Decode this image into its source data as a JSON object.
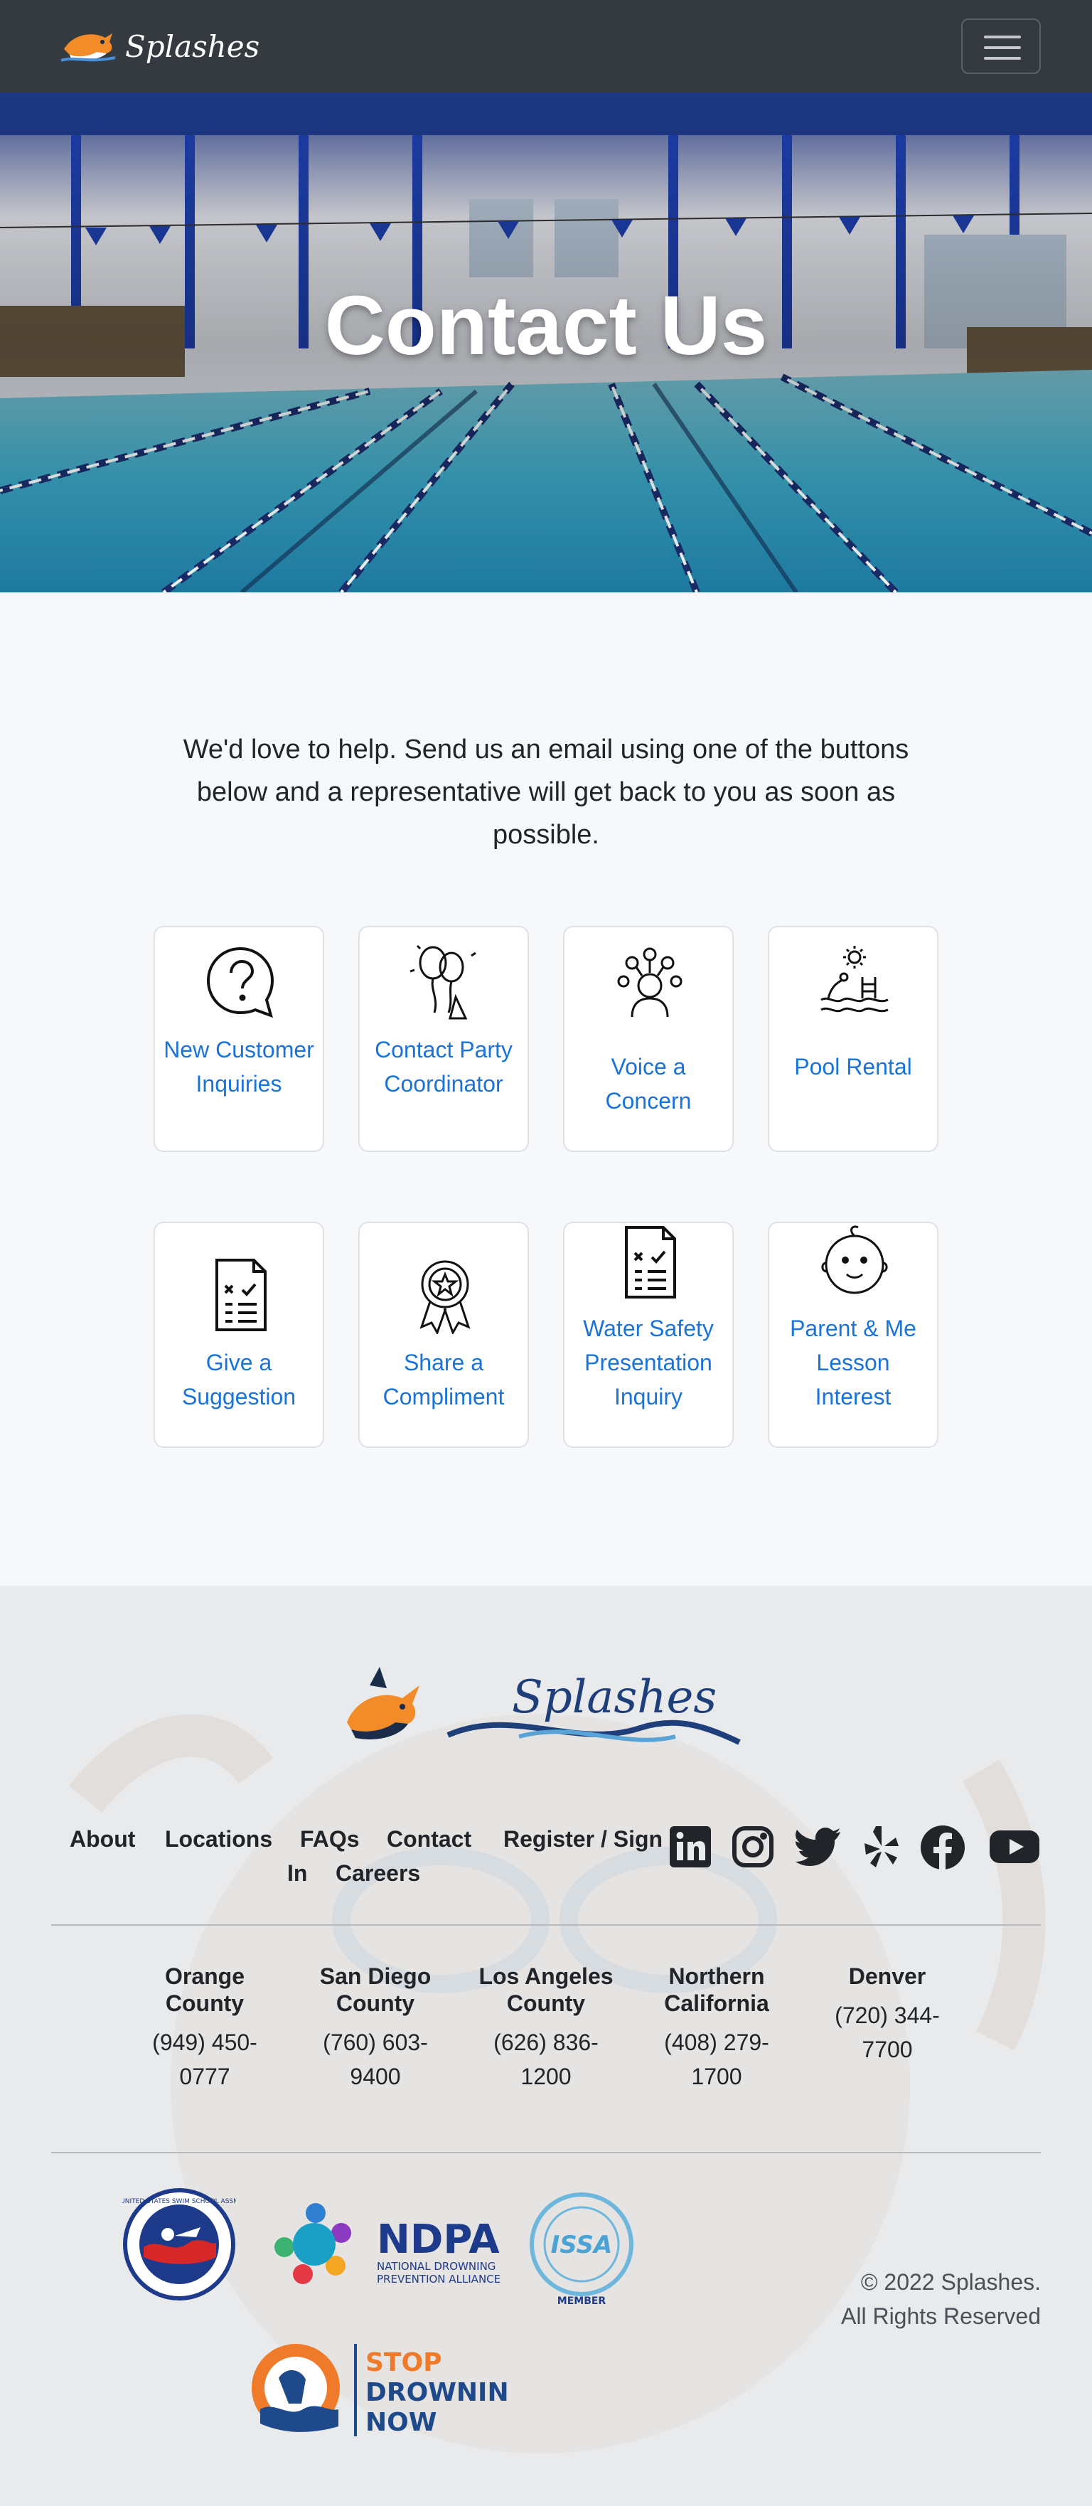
{
  "navbar": {
    "brand": "Splashes",
    "menu_icon": "hamburger-menu-icon"
  },
  "hero": {
    "title": "Contact Us"
  },
  "intro": {
    "text": "We'd love to help. Send us an email using one of the buttons below and a representative will get back to you as soon as possible."
  },
  "cards": [
    {
      "label": "New Customer Inquiries",
      "icon": "question-bubble-icon"
    },
    {
      "label": "Contact Party Coordinator",
      "icon": "balloons-icon"
    },
    {
      "label": "Voice a Concern",
      "icon": "concern-person-icon"
    },
    {
      "label": "Pool Rental",
      "icon": "pool-ladder-icon"
    },
    {
      "label": "Give a Suggestion",
      "icon": "checklist-document-icon"
    },
    {
      "label": "Share a Compliment",
      "icon": "award-ribbon-icon"
    },
    {
      "label": "Water Safety Presentation Inquiry",
      "icon": "checklist-document-icon"
    },
    {
      "label": "Parent & Me Lesson Interest",
      "icon": "baby-face-icon"
    }
  ],
  "footer": {
    "logo_text": "Splashes",
    "nav": {
      "about": "About",
      "locations": "Locations",
      "faqs": "FAQs",
      "contact": "Contact",
      "register": "Register / Sign",
      "register_cont": "In",
      "careers": "Careers"
    },
    "social": [
      "linkedin-icon",
      "instagram-icon",
      "twitter-icon",
      "yelp-icon",
      "facebook-icon",
      "youtube-icon"
    ],
    "regions": [
      {
        "name_1": "Orange",
        "name_2": "County",
        "phone_1": "(949) 450-",
        "phone_2": "0777"
      },
      {
        "name_1": "San Diego",
        "name_2": "County",
        "phone_1": "(760) 603-",
        "phone_2": "9400"
      },
      {
        "name_1": "Los Angeles",
        "name_2": "County",
        "phone_1": "(626) 836-",
        "phone_2": "1200"
      },
      {
        "name_1": "Northern",
        "name_2": "California",
        "phone_1": "(408) 279-",
        "phone_2": "1700"
      },
      {
        "name_1": "Denver",
        "name_2": "",
        "phone_1": "(720) 344-",
        "phone_2": "7700"
      }
    ],
    "badges": {
      "ndpa": "NDPA",
      "ndpa_sub_1": "NATIONAL DROWNING",
      "ndpa_sub_2": "PREVENTION ALLIANCE",
      "issa": "ISSA",
      "issa_member": "MEMBER",
      "usss_ring": "UNITED STATES SWIM SCHOOL ASSN",
      "stop_1": "STOP",
      "stop_2": "DROWNING",
      "stop_3": "NOW"
    },
    "copyright_1": "© 2022 Splashes.",
    "copyright_2": "All Rights Reserved"
  }
}
